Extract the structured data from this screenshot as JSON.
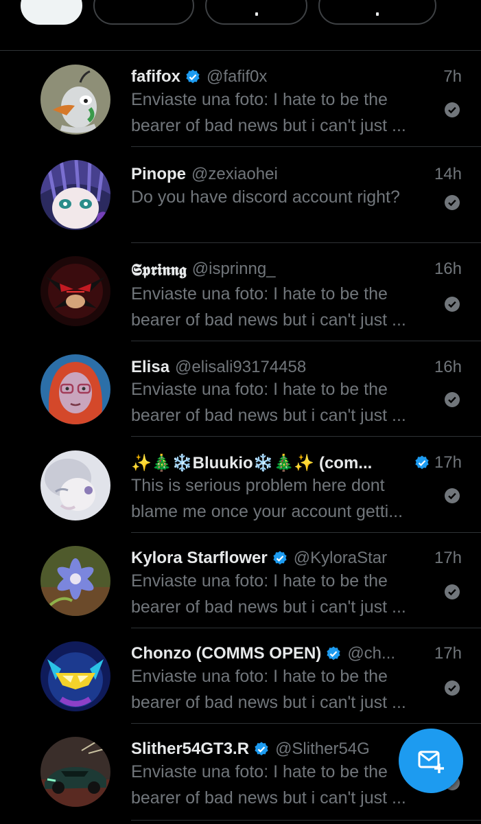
{
  "colors": {
    "background": "#000000",
    "primary_text": "#e7e9ea",
    "secondary_text": "#71767b",
    "divider": "#2f3336",
    "accent": "#1d9bf0"
  },
  "filter_tabs": [
    {
      "icon": "active-pill",
      "selected": true
    },
    {
      "icon": "chip",
      "selected": false
    },
    {
      "icon": "chip",
      "selected": false
    },
    {
      "icon": "chip",
      "selected": false
    }
  ],
  "conversations": [
    {
      "name": "fafifox",
      "verified": true,
      "handle": "@fafif0x",
      "time": "7h",
      "preview_line1": "Enviaste una foto: I hate to be the",
      "preview_line2": "bearer of bad news but i can't just ...",
      "read_icon": "check-circle-icon"
    },
    {
      "name": "Pinope",
      "verified": false,
      "handle": "@zexiaohei",
      "time": "14h",
      "preview_line1": "Do you have discord account right?",
      "preview_line2": "",
      "read_icon": "check-circle-icon"
    },
    {
      "name": "𝕾𝖕𝖗𝖎𝖓𝖓𝖌",
      "verified": false,
      "handle": "@isprinng_",
      "time": "16h",
      "preview_line1": "Enviaste una foto: I hate to be the",
      "preview_line2": "bearer of bad news but i can't just ...",
      "read_icon": "check-circle-icon"
    },
    {
      "name": "Elisa",
      "verified": false,
      "handle": "@elisali93174458",
      "time": "16h",
      "preview_line1": "Enviaste una foto: I hate to be the",
      "preview_line2": "bearer of bad news but i can't just ...",
      "read_icon": "check-circle-icon"
    },
    {
      "name": "✨🎄❄️Bluukio❄️🎄✨ (com...",
      "verified": true,
      "handle": "",
      "time": "17h",
      "preview_line1": "This is serious problem here dont",
      "preview_line2": "blame me once your account getti...",
      "read_icon": "check-circle-icon"
    },
    {
      "name": "Kylora Starflower",
      "verified": true,
      "handle": "@KyloraStar",
      "time": "17h",
      "preview_line1": "Enviaste una foto: I hate to be the",
      "preview_line2": "bearer of bad news but i can't just ...",
      "read_icon": "check-circle-icon"
    },
    {
      "name": "Chonzo (COMMS OPEN)",
      "verified": true,
      "handle": "@ch...",
      "time": "17h",
      "preview_line1": "Enviaste una foto: I hate to be the",
      "preview_line2": "bearer of bad news but i can't just ...",
      "read_icon": "check-circle-icon"
    },
    {
      "name": "Slither54GT3.R",
      "verified": true,
      "handle": "@Slither54G",
      "time": "",
      "preview_line1": "Enviaste una foto: I hate to be the",
      "preview_line2": "bearer of bad news but i can't just ...",
      "read_icon": "check-circle-icon"
    }
  ],
  "compose_button": {
    "icon": "new-message-icon"
  }
}
